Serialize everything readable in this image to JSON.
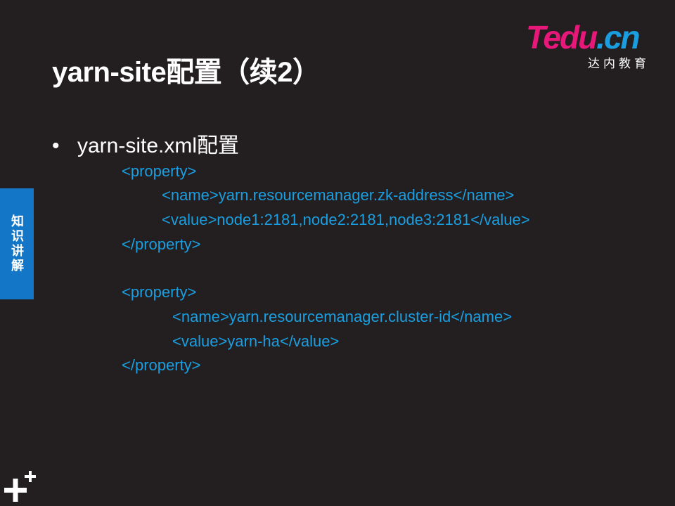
{
  "slide": {
    "title": "yarn-site配置（续2）",
    "section_tab": "知识讲解",
    "bullet": "yarn-site.xml配置"
  },
  "logo": {
    "main": "Tedu",
    "dot_text": ".cn",
    "sub": "达内教育"
  },
  "code_lines": [
    "<property>",
    "<name>yarn.resourcemanager.zk-address</name>",
    "<value>node1:2181,node2:2181,node3:2181</value>",
    "</property>",
    "<property>",
    "<name>yarn.resourcemanager.cluster-id</name>",
    "<value>yarn-ha</value>",
    "</property>"
  ],
  "colors": {
    "background": "#231f20",
    "code": "#1a9ee0",
    "tab": "#1376c7",
    "logo_pink": "#e8177a"
  },
  "icons": {
    "bottom_left": "plus-plus-icon"
  }
}
